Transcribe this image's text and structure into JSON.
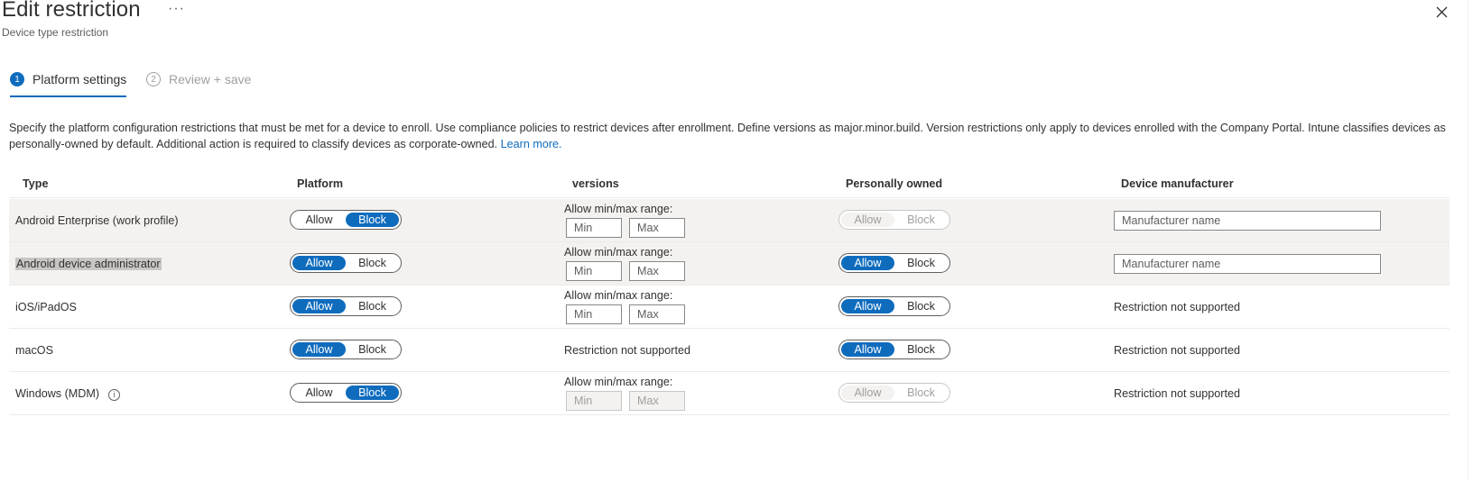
{
  "header": {
    "title": "Edit restriction",
    "more_label": "···",
    "subtitle": "Device type restriction"
  },
  "wizard": {
    "steps": [
      {
        "number": "1",
        "label": "Platform settings",
        "state": "active"
      },
      {
        "number": "2",
        "label": "Review + save",
        "state": "inactive"
      }
    ]
  },
  "description": {
    "text": "Specify the platform configuration restrictions that must be met for a device to enroll. Use compliance policies to restrict devices after enrollment. Define versions as major.minor.build. Version restrictions only apply to devices enrolled with the Company Portal. Intune classifies devices as personally-owned by default. Additional action is required to classify devices as corporate-owned.",
    "link": "Learn more."
  },
  "table": {
    "columns": [
      "Type",
      "Platform",
      "versions",
      "Personally owned",
      "Device manufacturer"
    ],
    "range_label": "Allow min/max range:",
    "min_placeholder": "Min",
    "max_placeholder": "Max",
    "manufacturer_placeholder": "Manufacturer name",
    "not_supported": "Restriction not supported",
    "allow_label": "Allow",
    "block_label": "Block",
    "rows": [
      {
        "type": "Android Enterprise (work profile)",
        "platform": "Block",
        "versions": "range",
        "personally_owned": "Allow",
        "personally_owned_disabled": true,
        "manufacturer": "input"
      },
      {
        "type": "Android device administrator",
        "platform": "Allow",
        "versions": "range",
        "personally_owned": "Allow",
        "personally_owned_disabled": false,
        "manufacturer": "input"
      },
      {
        "type": "iOS/iPadOS",
        "platform": "Allow",
        "versions": "range",
        "personally_owned": "Allow",
        "personally_owned_disabled": false,
        "manufacturer": "not_supported"
      },
      {
        "type": "macOS",
        "platform": "Allow",
        "versions": "not_supported",
        "personally_owned": "Allow",
        "personally_owned_disabled": false,
        "manufacturer": "not_supported"
      },
      {
        "type": "Windows (MDM)",
        "platform": "Block",
        "versions": "range",
        "personally_owned": "Allow",
        "personally_owned_disabled": true,
        "manufacturer": "not_supported"
      }
    ]
  },
  "colors": {
    "accent": "#0f6cbd",
    "row_shaded": "#f3f2f1",
    "text": "#323130"
  }
}
